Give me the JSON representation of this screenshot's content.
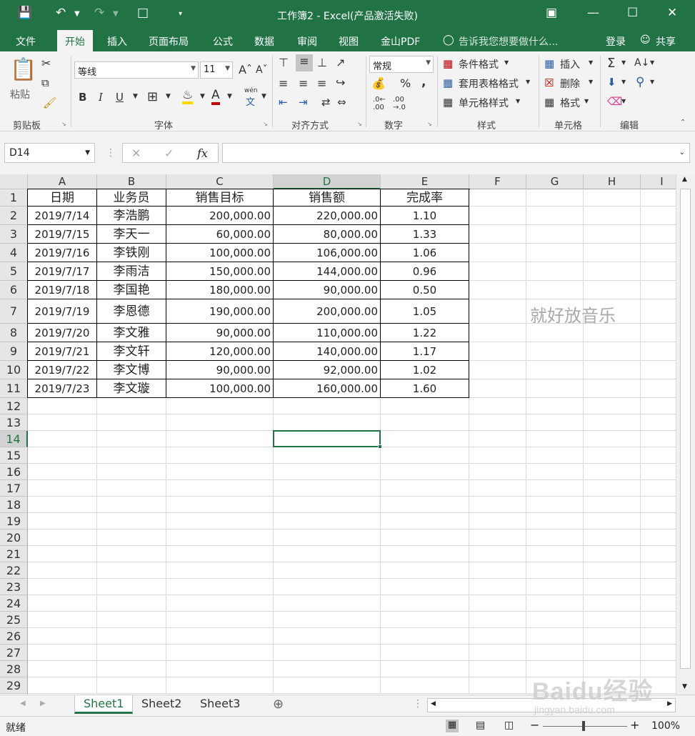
{
  "title": "工作簿2 - Excel(产品激活失败)",
  "menu": {
    "file": "文件",
    "home": "开始",
    "insert": "插入",
    "layout": "页面布局",
    "formula": "公式",
    "data": "数据",
    "review": "审阅",
    "view": "视图",
    "jinshan": "金山PDF",
    "tellme": "告诉我您想要做什么...",
    "login": "登录",
    "share": "共享"
  },
  "ribbon": {
    "clipboard": {
      "paste": "粘贴",
      "label": "剪贴板"
    },
    "font": {
      "name": "等线",
      "size": "11",
      "label": "字体",
      "bold": "B",
      "italic": "I",
      "underline": "U",
      "pinyin": "wén"
    },
    "align": {
      "label": "对齐方式"
    },
    "number": {
      "format": "常规",
      "label": "数字",
      "percent": "%",
      "comma": ","
    },
    "styles": {
      "conditional": "条件格式",
      "table": "套用表格格式",
      "cell": "单元格样式",
      "label": "样式"
    },
    "cells": {
      "insert": "插入",
      "delete": "删除",
      "format": "格式",
      "label": "单元格"
    },
    "editing": {
      "label": "编辑"
    }
  },
  "formula_bar": {
    "name_box": "D14",
    "value": "",
    "fx": "fx"
  },
  "columns": [
    "A",
    "B",
    "C",
    "D",
    "E",
    "F",
    "G",
    "H",
    "I"
  ],
  "rows": [
    "1",
    "2",
    "3",
    "4",
    "5",
    "6",
    "7",
    "8",
    "9",
    "10",
    "11",
    "12",
    "13",
    "14",
    "15",
    "16",
    "17",
    "18",
    "19",
    "20",
    "21",
    "22",
    "23",
    "24",
    "25",
    "26",
    "27",
    "28",
    "29"
  ],
  "header_row": [
    "日期",
    "业务员",
    "销售目标",
    "销售额",
    "完成率"
  ],
  "table": [
    [
      "2019/7/14",
      "李浩鹏",
      "200,000.00",
      "220,000.00",
      "1.10"
    ],
    [
      "2019/7/15",
      "李天一",
      "60,000.00",
      "80,000.00",
      "1.33"
    ],
    [
      "2019/7/16",
      "李铁刚",
      "100,000.00",
      "106,000.00",
      "1.06"
    ],
    [
      "2019/7/17",
      "李雨洁",
      "150,000.00",
      "144,000.00",
      "0.96"
    ],
    [
      "2019/7/18",
      "李国艳",
      "180,000.00",
      "90,000.00",
      "0.50"
    ],
    [
      "2019/7/19",
      "李恩德",
      "190,000.00",
      "200,000.00",
      "1.05"
    ],
    [
      "2019/7/20",
      "李文雅",
      "90,000.00",
      "110,000.00",
      "1.22"
    ],
    [
      "2019/7/21",
      "李文轩",
      "120,000.00",
      "140,000.00",
      "1.17"
    ],
    [
      "2019/7/22",
      "李文博",
      "90,000.00",
      "92,000.00",
      "1.02"
    ],
    [
      "2019/7/23",
      "李文璇",
      "100,000.00",
      "160,000.00",
      "1.60"
    ]
  ],
  "overlay_text": "就好放音乐",
  "sheets": [
    "Sheet1",
    "Sheet2",
    "Sheet3"
  ],
  "status": {
    "ready": "就绪",
    "zoom": "100%"
  },
  "watermark": {
    "brand": "Baidu经验",
    "url": "jingyan.baidu.com"
  }
}
